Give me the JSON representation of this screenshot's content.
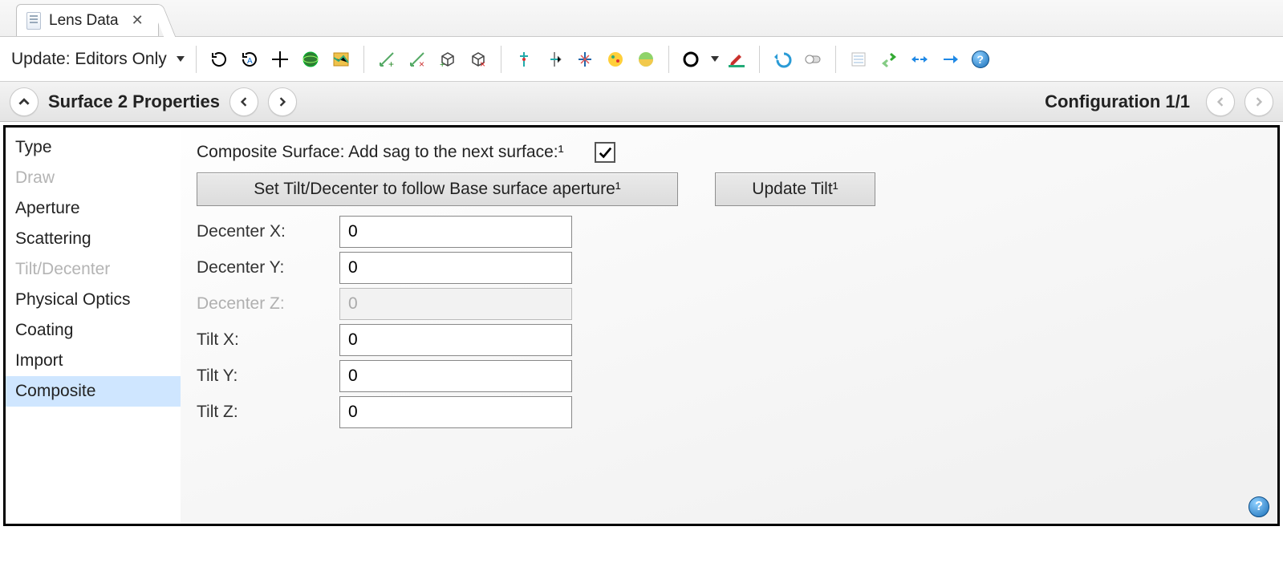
{
  "tab": {
    "title": "Lens Data"
  },
  "toolbar": {
    "update_label": "Update: Editors Only"
  },
  "header": {
    "collapse_icon": "^",
    "title": "Surface   2 Properties",
    "prev": "<",
    "next": ">",
    "config_label": "Configuration 1/1"
  },
  "sidemenu": {
    "items": [
      {
        "label": "Type",
        "disabled": false
      },
      {
        "label": "Draw",
        "disabled": true
      },
      {
        "label": "Aperture",
        "disabled": false
      },
      {
        "label": "Scattering",
        "disabled": false
      },
      {
        "label": "Tilt/Decenter",
        "disabled": true
      },
      {
        "label": "Physical Optics",
        "disabled": false
      },
      {
        "label": "Coating",
        "disabled": false
      },
      {
        "label": "Import",
        "disabled": false
      },
      {
        "label": "Composite",
        "disabled": false,
        "selected": true
      }
    ]
  },
  "content": {
    "composite_label": "Composite Surface: Add sag to the next surface:¹",
    "composite_checked": true,
    "btn_set_tilt": "Set Tilt/Decenter to follow Base surface aperture¹",
    "btn_update_tilt": "Update Tilt¹",
    "fields": {
      "decenter_x": {
        "label": "Decenter X:",
        "value": "0",
        "disabled": false
      },
      "decenter_y": {
        "label": "Decenter Y:",
        "value": "0",
        "disabled": false
      },
      "decenter_z": {
        "label": "Decenter Z:",
        "value": "0",
        "disabled": true
      },
      "tilt_x": {
        "label": "Tilt X:",
        "value": "0",
        "disabled": false
      },
      "tilt_y": {
        "label": "Tilt Y:",
        "value": "0",
        "disabled": false
      },
      "tilt_z": {
        "label": "Tilt Z:",
        "value": "0",
        "disabled": false
      }
    }
  },
  "help": "?"
}
